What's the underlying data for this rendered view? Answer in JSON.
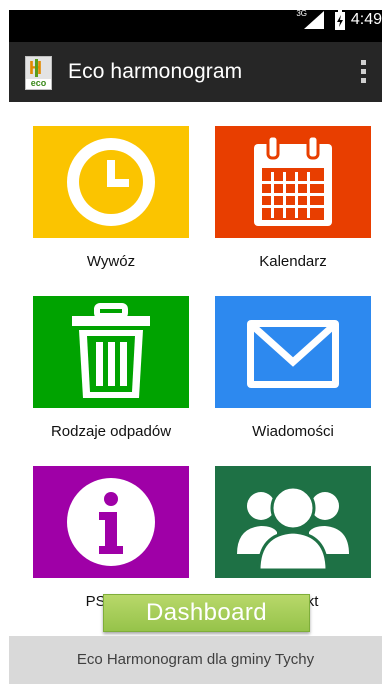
{
  "status_bar": {
    "network": "3G",
    "time": "4:49"
  },
  "app_bar": {
    "logo_text": "eco",
    "title": "Eco harmonogram",
    "overflow_icon": "more-vert-icon"
  },
  "tiles": [
    {
      "label": "Wywóz",
      "icon": "clock-icon",
      "color": "#fbc400"
    },
    {
      "label": "Kalendarz",
      "icon": "calendar-icon",
      "color": "#e83e00"
    },
    {
      "label": "Rodzaje odpadów",
      "icon": "trash-icon",
      "color": "#00a300"
    },
    {
      "label": "Wiadomości",
      "icon": "mail-icon",
      "color": "#2d89ef"
    },
    {
      "label": "PSZOK",
      "icon": "info-icon",
      "color": "#9f00a7"
    },
    {
      "label": "Kontakt",
      "icon": "group-icon",
      "color": "#1e7145"
    }
  ],
  "toast": {
    "text": "Dashboard"
  },
  "footer": {
    "text": "Eco Harmonogram dla gminy Tychy"
  }
}
